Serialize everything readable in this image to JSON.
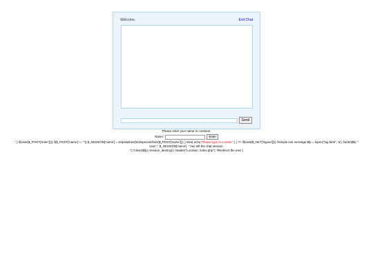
{
  "chat": {
    "welcome_text": "Welcome, ",
    "exit_label": "Exit Chat",
    "send_label": "Send",
    "message_value": ""
  },
  "login": {
    "prompt": "Please enter your name to continue:",
    "name_label": "Name:",
    "name_value": "",
    "enter_label": "Enter"
  },
  "leaked_code": {
    "line1_pre": "'; } if(isset($_POST['enter'])){ if($_POST['name'] != \"\"){ $_SESSION['name'] = stripslashes(htmlspecialchars($_POST['name'])); } else{ echo '",
    "line1_error": "Please type in a name",
    "line1_post": "'; } } ?> if(isset($_GET['logout'])){ //Simple exit message $fp = fopen(\"log.html\", 'a'); fwrite($fp, \"",
    "line2": "User \". $_SESSION['name'] .\" has left the chat session.",
    "line3": "\"); fclose($fp); session_destroy(); header(\"Location: index.php\"); //Redirect the user }"
  },
  "colors": {
    "panel_bg": "#ebf4fb",
    "panel_border": "#acd8f0",
    "link": "#0000ee",
    "error": "#ff0000"
  }
}
